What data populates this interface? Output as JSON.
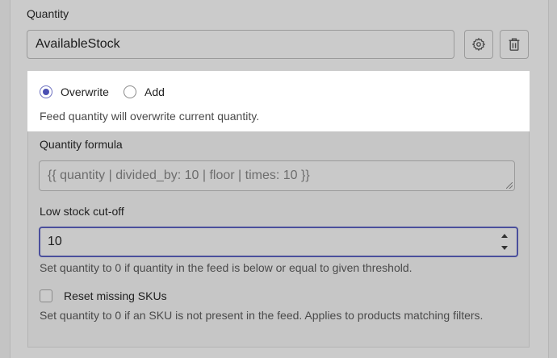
{
  "quantity": {
    "label": "Quantity",
    "field_value": "AvailableStock",
    "settings_icon": "gear-icon",
    "delete_icon": "trash-icon"
  },
  "mode": {
    "options": [
      {
        "label": "Overwrite",
        "selected": true
      },
      {
        "label": "Add",
        "selected": false
      }
    ],
    "help": "Feed quantity will overwrite current quantity."
  },
  "formula": {
    "label": "Quantity formula",
    "placeholder": "{{ quantity | divided_by: 10 | floor | times: 10 }}"
  },
  "cutoff": {
    "label": "Low stock cut-off",
    "value": "10",
    "help": "Set quantity to 0 if quantity in the feed is below or equal to given threshold."
  },
  "reset": {
    "label": "Reset missing SKUs",
    "checked": false,
    "help": "Set quantity to 0 if an SKU is not present in the feed. Applies to products matching filters."
  },
  "colors": {
    "accent": "#4a4fb3",
    "focus_border": "#4a4f9c"
  }
}
